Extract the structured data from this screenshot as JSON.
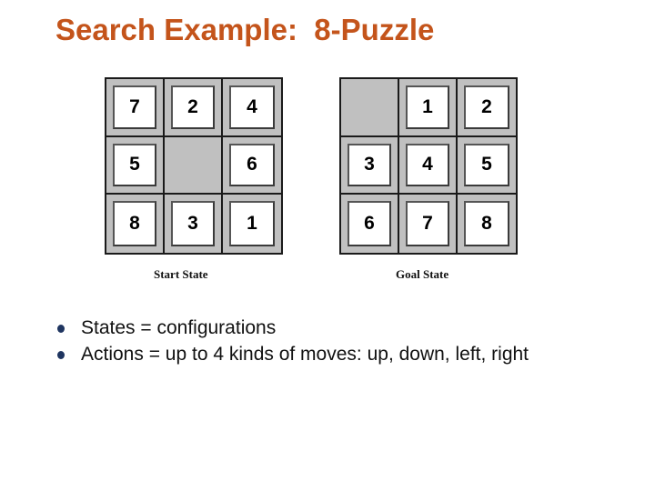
{
  "slide": {
    "title": "Search Example:  8-Puzzle",
    "colors": {
      "title": "#c4541b",
      "bullet": "#1f3560",
      "board": "#c0c0c0"
    }
  },
  "puzzles": {
    "start": {
      "caption": "Start State",
      "tiles": [
        "7",
        "2",
        "4",
        "5",
        "",
        "6",
        "8",
        "3",
        "1"
      ]
    },
    "goal": {
      "caption": "Goal State",
      "tiles": [
        "",
        "1",
        "2",
        "3",
        "4",
        "5",
        "6",
        "7",
        "8"
      ]
    }
  },
  "bullets": [
    {
      "text": "States = configurations"
    },
    {
      "text": "Actions = up to 4 kinds of moves: up, down, left, right"
    }
  ]
}
